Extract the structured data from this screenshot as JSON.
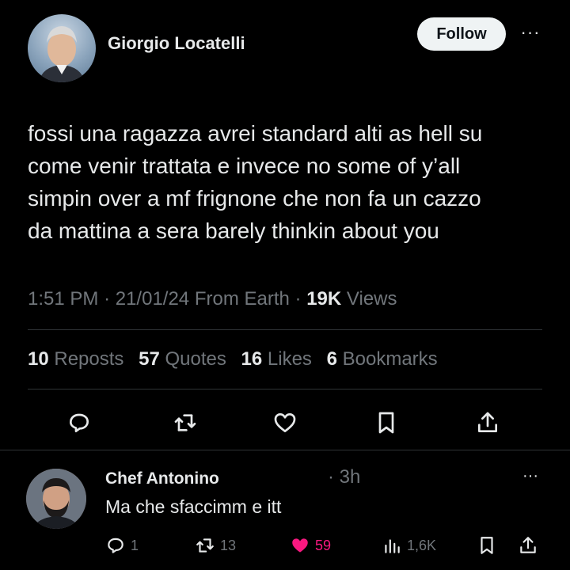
{
  "post": {
    "author_name": "Giorgio Locatelli",
    "follow_label": "Follow",
    "more_label": "···",
    "text_lines": [
      "fossi una ragazza avrei standard alti as hell su",
      "come venir trattata e invece no some of y’all",
      "simpin over a mf frignone che non fa un cazzo",
      "da mattina a sera barely thinkin about you"
    ],
    "time": "1:51 PM",
    "date": "21/01/24",
    "source": "From Earth",
    "views_count": "19K",
    "views_label": "Views",
    "sep": "·"
  },
  "stats": {
    "reposts_count": "10",
    "reposts_label": "Reposts",
    "quotes_count": "57",
    "quotes_label": "Quotes",
    "likes_count": "16",
    "likes_label": "Likes",
    "bookmarks_count": "6",
    "bookmarks_label": "Bookmarks"
  },
  "reply": {
    "author_name": "Chef Antonino",
    "time": "· 3h",
    "text": "Ma che sfaccimm e itt",
    "more_label": "···",
    "replies": "1",
    "reposts": "13",
    "likes": "59",
    "views": "1,6K"
  },
  "colors": {
    "background": "#000000",
    "text": "#e7e9ea",
    "muted": "#71767b",
    "divider": "#2f3336",
    "like_pink": "#f91880"
  }
}
